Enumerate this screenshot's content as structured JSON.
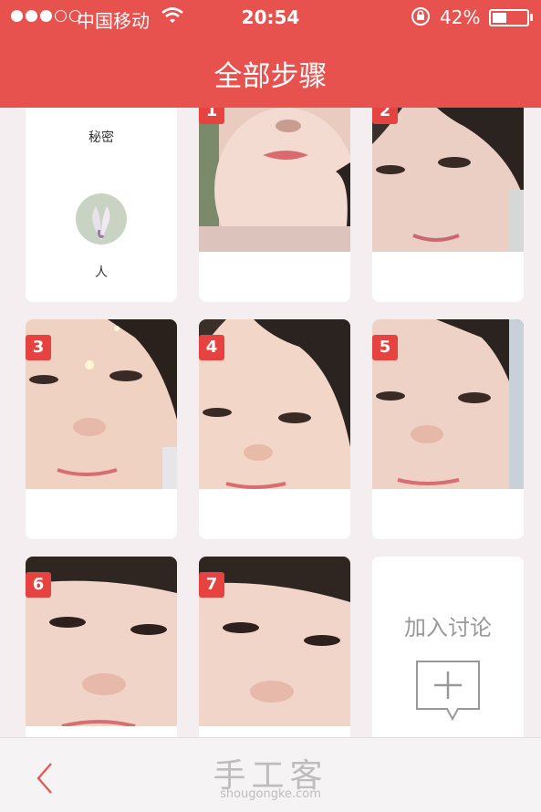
{
  "status_bar": {
    "carrier": "中国移动",
    "time": "20:54",
    "battery_percent": "42%",
    "battery_level": 0.42
  },
  "header": {
    "title": "全部步骤"
  },
  "intro_card": {
    "label": "秘密",
    "author": "人"
  },
  "steps": [
    {
      "number": "1"
    },
    {
      "number": "2"
    },
    {
      "number": "3"
    },
    {
      "number": "4"
    },
    {
      "number": "5"
    },
    {
      "number": "6"
    },
    {
      "number": "7"
    }
  ],
  "join_card": {
    "label": "加入讨论",
    "icon": "add-comment-icon"
  },
  "bottom_bar": {
    "logo": "手工客",
    "domain": "shougongke.com",
    "back_icon": "chevron-left-icon"
  },
  "colors": {
    "accent": "#e8524e",
    "badge": "#e6423f",
    "background": "#f4eef0"
  }
}
